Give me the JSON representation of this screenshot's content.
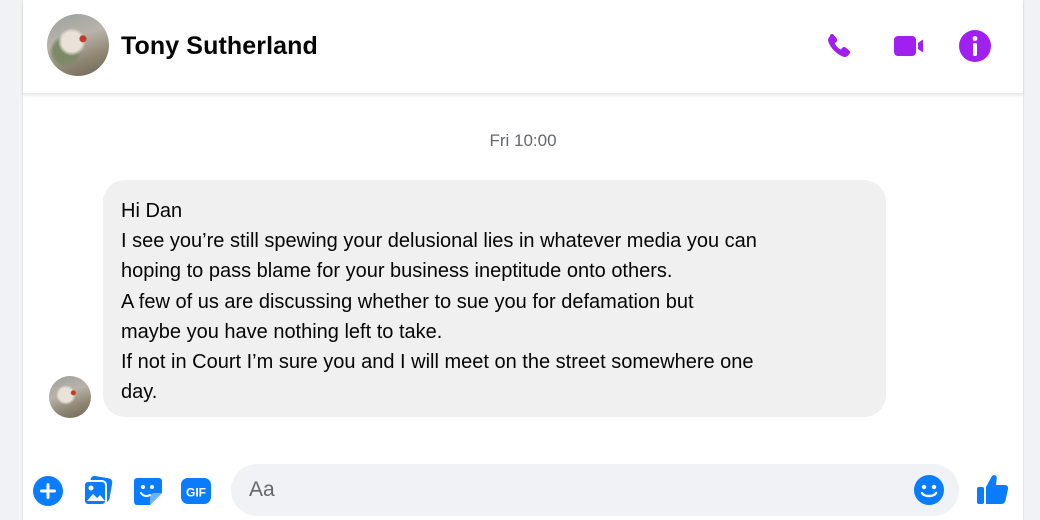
{
  "header": {
    "contact_name": "Tony Sutherland",
    "icons": [
      "phone-icon",
      "video-camera-icon",
      "info-icon"
    ]
  },
  "thread": {
    "timestamp": "Fri 10:00",
    "message": {
      "lines": [
        "Hi Dan",
        "I see you’re still spewing your delusional lies in whatever media you can",
        "hoping to pass blame for your business ineptitude onto others.",
        "A few of us are discussing whether to sue you for defamation but",
        "maybe you have nothing left to take.",
        "If not in Court I’m sure you and I will meet on the street somewhere one",
        "day."
      ]
    }
  },
  "composer": {
    "placeholder": "Aa",
    "value": "",
    "icons": [
      "plus-icon",
      "photo-icon",
      "sticker-icon",
      "gif-icon",
      "emoji-icon",
      "thumbs-up-icon"
    ],
    "gif_label": "GIF"
  },
  "colors": {
    "accent_purple": "#a020f0",
    "composer_blue": "#0a7cff",
    "bubble_bg": "#f0f0f0"
  }
}
